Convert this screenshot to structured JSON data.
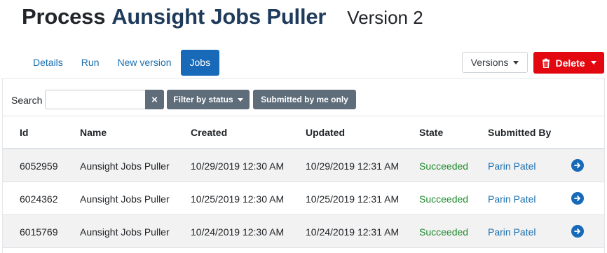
{
  "header": {
    "title_prefix": "Process",
    "title_name": "Aunsight Jobs Puller",
    "version": "Version 2"
  },
  "tabs": [
    {
      "label": "Details",
      "active": false
    },
    {
      "label": "Run",
      "active": false
    },
    {
      "label": "New version",
      "active": false
    },
    {
      "label": "Jobs",
      "active": true
    }
  ],
  "actions": {
    "versions_label": "Versions",
    "delete_label": "Delete"
  },
  "filters": {
    "search_label": "Search",
    "search_value": "",
    "clear_icon": "×",
    "status_label": "Filter by status",
    "mine_label": "Submitted by me only"
  },
  "table": {
    "columns": [
      "Id",
      "Name",
      "Created",
      "Updated",
      "State",
      "Submitted By"
    ],
    "rows": [
      {
        "id": "6052959",
        "name": "Aunsight Jobs Puller",
        "created": "10/29/2019 12:30 AM",
        "updated": "10/29/2019 12:31 AM",
        "state": "Succeeded",
        "submitted_by": "Parin Patel"
      },
      {
        "id": "6024362",
        "name": "Aunsight Jobs Puller",
        "created": "10/25/2019 12:30 AM",
        "updated": "10/25/2019 12:31 AM",
        "state": "Succeeded",
        "submitted_by": "Parin Patel"
      },
      {
        "id": "6015769",
        "name": "Aunsight Jobs Puller",
        "created": "10/24/2019 12:30 AM",
        "updated": "10/24/2019 12:31 AM",
        "state": "Succeeded",
        "submitted_by": "Parin Patel"
      }
    ]
  },
  "colors": {
    "primary": "#1869b8",
    "danger": "#e3080f",
    "success_text": "#1f8a2e",
    "secondary_btn": "#5f6d7a",
    "title_accent": "#1f3b5c"
  },
  "icons": {
    "delete": "trash-icon",
    "dropdown": "caret-down-icon",
    "clear": "close-icon",
    "row_action": "arrow-circle-right-icon"
  }
}
